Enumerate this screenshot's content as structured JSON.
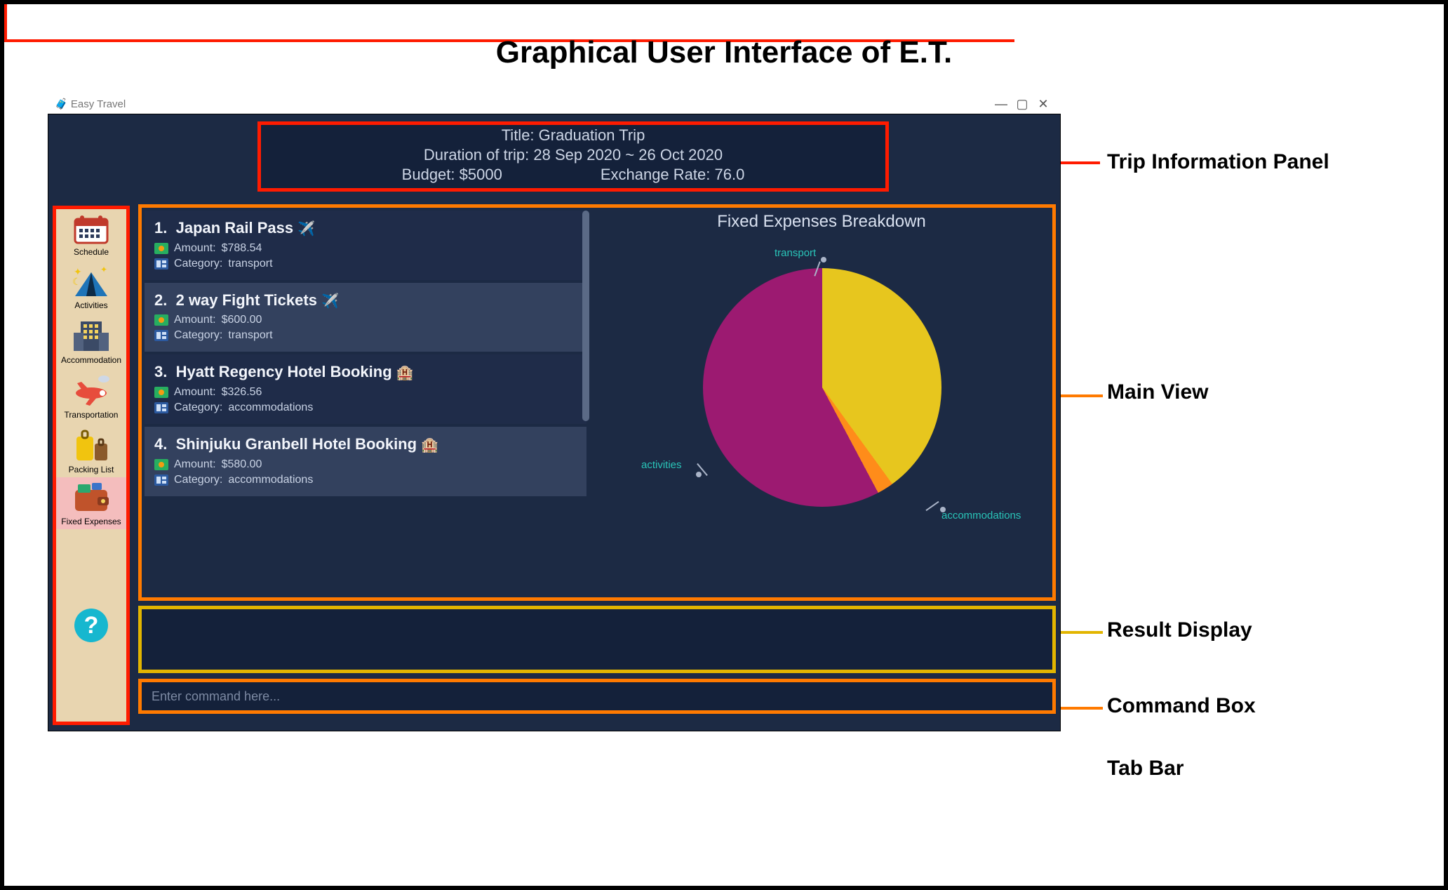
{
  "page_title": "Graphical User Interface of E.T.",
  "annotations": {
    "trip_info": "Trip Information Panel",
    "main_view": "Main View",
    "result_display": "Result Display",
    "command_box": "Command Box",
    "tab_bar": "Tab Bar"
  },
  "window": {
    "app_name": "Easy Travel"
  },
  "trip": {
    "title_label": "Title: ",
    "title_value": "Graduation Trip",
    "duration_label": "Duration of trip: ",
    "duration_value": "28 Sep 2020 ~ 26 Oct 2020",
    "budget_label": "Budget: ",
    "budget_value": "$5000",
    "rate_label": "Exchange Rate: ",
    "rate_value": "76.0"
  },
  "tabs": [
    {
      "id": "schedule",
      "label": "Schedule"
    },
    {
      "id": "activities",
      "label": "Activities"
    },
    {
      "id": "accommodation",
      "label": "Accommodation"
    },
    {
      "id": "transportation",
      "label": "Transportation"
    },
    {
      "id": "packing",
      "label": "Packing List"
    },
    {
      "id": "fixed",
      "label": "Fixed Expenses",
      "selected": true
    },
    {
      "id": "help",
      "label": ""
    }
  ],
  "expenses": [
    {
      "n": "1.",
      "title": "Japan Rail Pass",
      "emoji": "✈️",
      "amount": "$788.54",
      "category": "transport",
      "alt": true
    },
    {
      "n": "2.",
      "title": "2 way Fight Tickets",
      "emoji": "✈️",
      "amount": "$600.00",
      "category": "transport",
      "alt": false
    },
    {
      "n": "3.",
      "title": "Hyatt Regency Hotel Booking",
      "emoji": "🏨",
      "amount": "$326.56",
      "category": "accommodations",
      "alt": true
    },
    {
      "n": "4.",
      "title": "Shinjuku Granbell Hotel Booking",
      "emoji": "🏨",
      "amount": "$580.00",
      "category": "accommodations",
      "alt": false
    }
  ],
  "meta_labels": {
    "amount": "Amount: ",
    "category": "Category: "
  },
  "chart_data": {
    "type": "pie",
    "title": "Fixed Expenses Breakdown",
    "series": [
      {
        "name": "accommodations",
        "value": 40,
        "color": "#e7c61e"
      },
      {
        "name": "activities",
        "value": 2,
        "color": "#ff8c1a"
      },
      {
        "name": "transport",
        "value": 58,
        "color": "#9c1a71"
      }
    ]
  },
  "command": {
    "placeholder": "Enter command here..."
  }
}
